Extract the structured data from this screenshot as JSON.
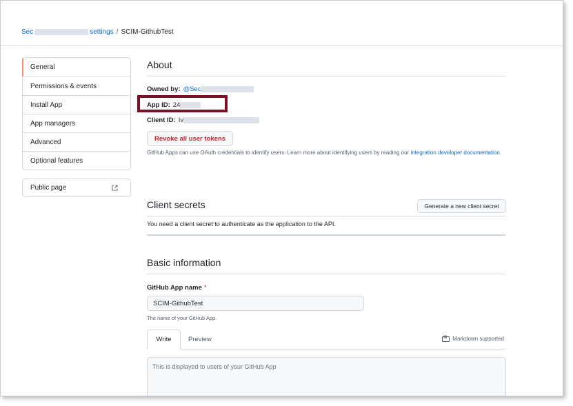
{
  "breadcrumb": {
    "parent_prefix": "Sec",
    "parent_suffix": "settings",
    "separator": "/",
    "current": "SCIM-GithubTest"
  },
  "sidebar": {
    "items": [
      {
        "label": "General",
        "selected": true
      },
      {
        "label": "Permissions & events"
      },
      {
        "label": "Install App"
      },
      {
        "label": "App managers"
      },
      {
        "label": "Advanced"
      },
      {
        "label": "Optional features"
      }
    ],
    "public_page": {
      "label": "Public page",
      "icon": "external-link-icon"
    }
  },
  "about": {
    "title": "About",
    "owned_by_label": "Owned by:",
    "owned_by_value": "@Sec",
    "app_id_label": "App ID:",
    "app_id_value": "24",
    "client_id_label": "Client ID:",
    "client_id_value": "Iv",
    "revoke_button": "Revoke all user tokens",
    "help_text": "GitHub Apps can use OAuth credentials to identify users. Learn more about identifying users by reading our ",
    "help_link": "integration developer documentation",
    "help_end": ".",
    "highlight_color": "#7b1026"
  },
  "client_secrets": {
    "title": "Client secrets",
    "generate_button": "Generate a new client secret",
    "description": "You need a client secret to authenticate as the application to the API."
  },
  "basic_info": {
    "title": "Basic information",
    "app_name_label": "GitHub App name",
    "required_marker": "*",
    "app_name_value": "SCIM-GithubTest",
    "app_name_note": "The name of your GitHub App.",
    "tab_write": "Write",
    "tab_preview": "Preview",
    "markdown_note": "Markdown supported",
    "description_placeholder": "This is displayed to users of your GitHub App"
  },
  "colors": {
    "link": "#0969da",
    "danger": "#cf222e",
    "selected_accent": "#fd8c73"
  }
}
